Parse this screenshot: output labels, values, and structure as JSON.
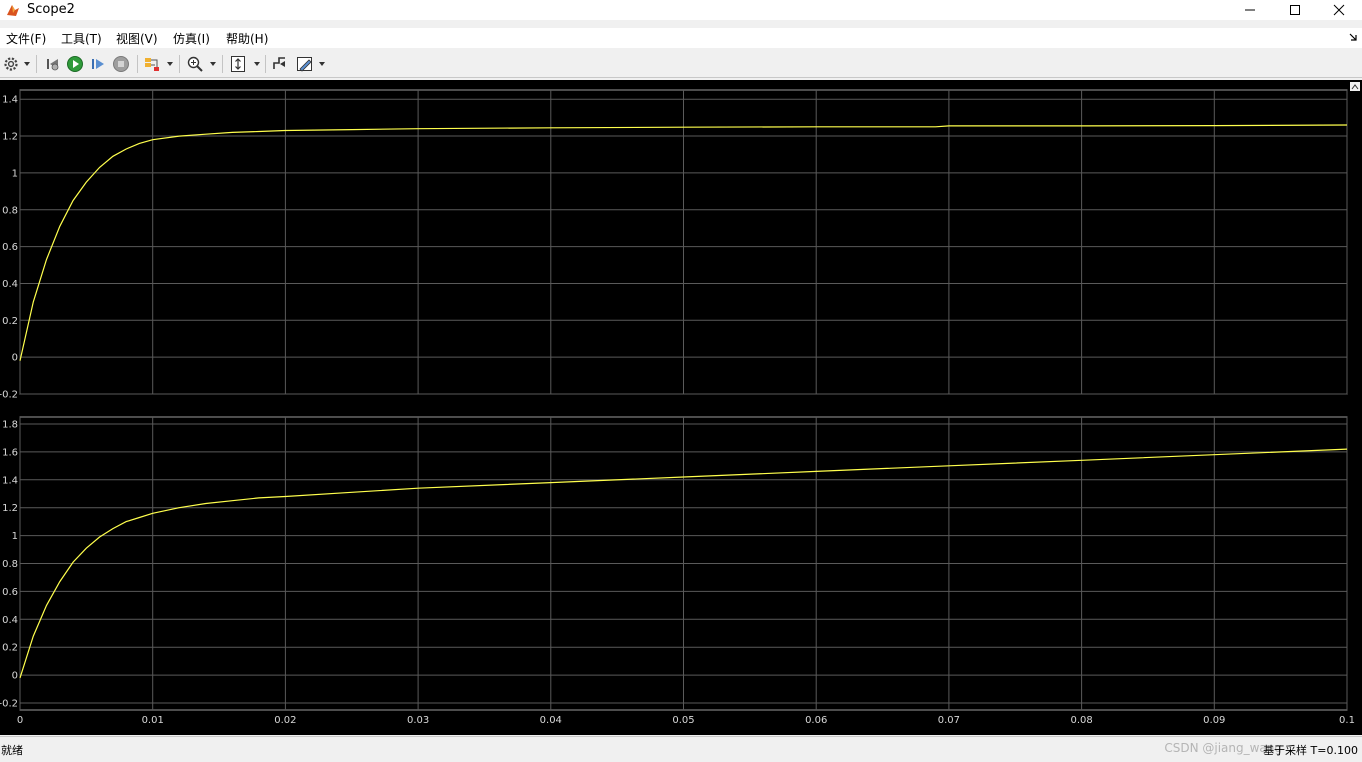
{
  "window": {
    "title": "Scope2",
    "icon": "matlab-icon",
    "controls": [
      "minimize-icon",
      "maximize-icon",
      "close-icon"
    ]
  },
  "menu": {
    "items": [
      "文件(F)",
      "工具(T)",
      "视图(V)",
      "仿真(I)",
      "帮助(H)"
    ]
  },
  "toolbar": {
    "icons": [
      "gear-icon",
      "step-back-icon",
      "run-icon",
      "step-forward-icon",
      "stop-icon",
      "highlight-icon",
      "zoom-icon",
      "autoscale-icon",
      "triggers-icon",
      "style-icon"
    ]
  },
  "colors": {
    "plot_background": "#000000",
    "grid": "#5a5a5a",
    "signal": "#ffff4d",
    "tick_text": "#d8d8d8"
  },
  "chart_data": [
    {
      "type": "line",
      "x": [
        0,
        0.001,
        0.002,
        0.003,
        0.004,
        0.005,
        0.006,
        0.007,
        0.008,
        0.009,
        0.01,
        0.012,
        0.014,
        0.016,
        0.018,
        0.02,
        0.025,
        0.03,
        0.04,
        0.05,
        0.06,
        0.069,
        0.07,
        0.08,
        0.09,
        0.1
      ],
      "series": [
        {
          "values": [
            -0.02,
            0.3,
            0.53,
            0.71,
            0.85,
            0.95,
            1.03,
            1.09,
            1.13,
            1.16,
            1.18,
            1.2,
            1.21,
            1.22,
            1.225,
            1.23,
            1.235,
            1.24,
            1.245,
            1.248,
            1.25,
            1.25,
            1.255,
            1.255,
            1.257,
            1.26
          ]
        }
      ],
      "xlim": [
        0,
        0.1
      ],
      "ylim": [
        -0.2,
        1.45
      ],
      "yticks": [
        "1.4",
        "1.2",
        "1",
        "0.8",
        "0.6",
        "0.4",
        "0.2",
        "0",
        "-0.2"
      ],
      "ytick_values": [
        1.4,
        1.2,
        1.0,
        0.8,
        0.6,
        0.4,
        0.2,
        0,
        -0.2
      ],
      "xticks": [
        0,
        0.01,
        0.02,
        0.03,
        0.04,
        0.05,
        0.06,
        0.07,
        0.08,
        0.09,
        0.1
      ],
      "grid": true
    },
    {
      "type": "line",
      "x": [
        0,
        0.001,
        0.002,
        0.003,
        0.004,
        0.005,
        0.006,
        0.007,
        0.008,
        0.009,
        0.01,
        0.012,
        0.014,
        0.016,
        0.018,
        0.02,
        0.025,
        0.03,
        0.04,
        0.05,
        0.06,
        0.07,
        0.08,
        0.09,
        0.1
      ],
      "series": [
        {
          "values": [
            -0.02,
            0.28,
            0.5,
            0.67,
            0.81,
            0.91,
            0.99,
            1.05,
            1.1,
            1.13,
            1.16,
            1.2,
            1.23,
            1.25,
            1.27,
            1.28,
            1.31,
            1.34,
            1.38,
            1.42,
            1.46,
            1.5,
            1.54,
            1.58,
            1.62
          ]
        }
      ],
      "xlim": [
        0,
        0.1
      ],
      "ylim": [
        -0.25,
        1.85
      ],
      "yticks": [
        "1.8",
        "1.6",
        "1.4",
        "1.2",
        "1",
        "0.8",
        "0.6",
        "0.4",
        "0.2",
        "0",
        "-0.2"
      ],
      "ytick_values": [
        1.8,
        1.6,
        1.4,
        1.2,
        1.0,
        0.8,
        0.6,
        0.4,
        0.2,
        0,
        -0.2
      ],
      "xticks": [
        0,
        0.01,
        0.02,
        0.03,
        0.04,
        0.05,
        0.06,
        0.07,
        0.08,
        0.09,
        0.1
      ],
      "xtick_labels": [
        "0",
        "0.01",
        "0.02",
        "0.03",
        "0.04",
        "0.05",
        "0.06",
        "0.07",
        "0.08",
        "0.09",
        "0.1"
      ],
      "grid": true
    }
  ],
  "status": {
    "left": "就绪",
    "right": "基于采样 T=0.100",
    "watermark": "CSDN @jiang_wang"
  }
}
